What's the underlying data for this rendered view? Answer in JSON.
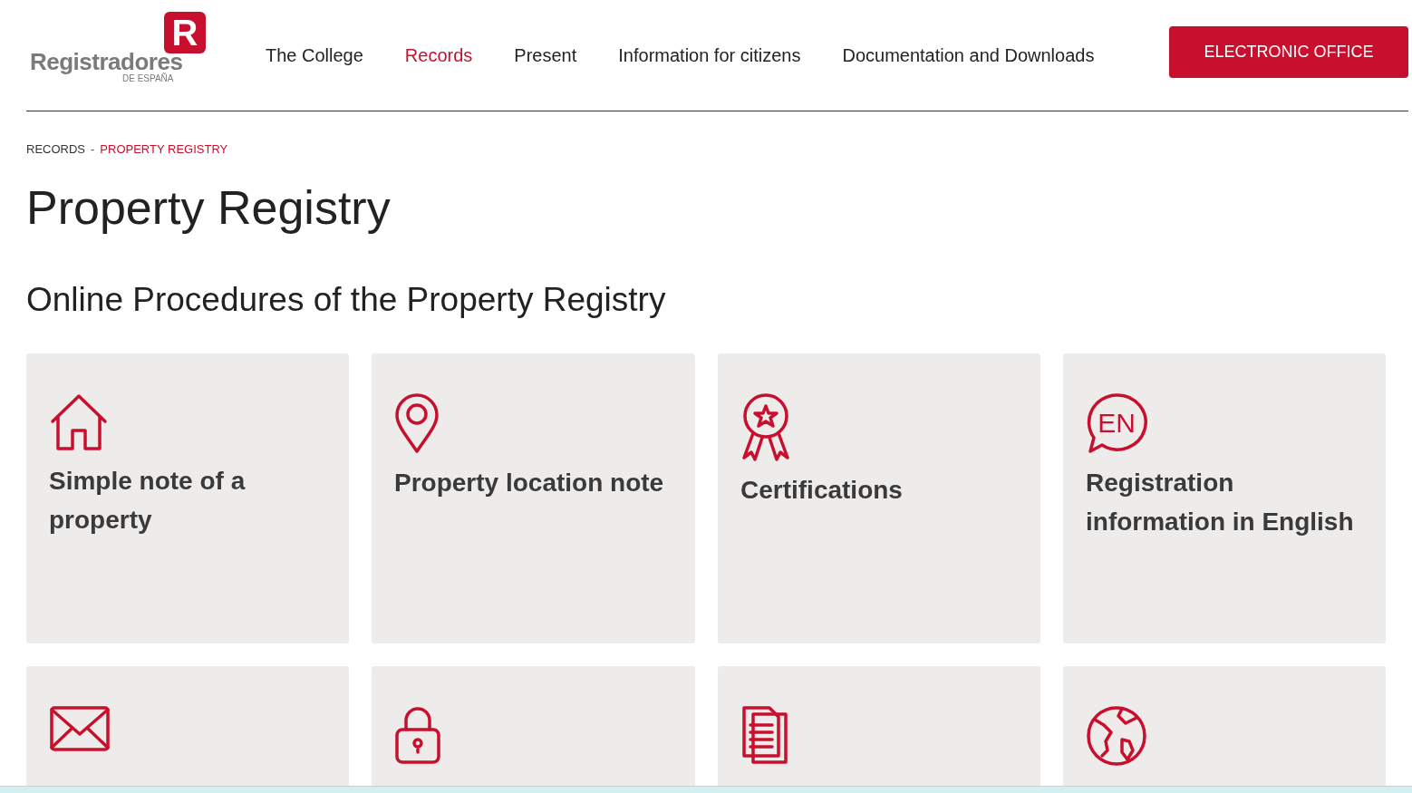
{
  "logo": {
    "mark": "R",
    "name": "Registradores",
    "subtitle": "DE ESPAÑA"
  },
  "nav": [
    {
      "label": "The College",
      "selected": false
    },
    {
      "label": "Records",
      "selected": true
    },
    {
      "label": "Present",
      "selected": false
    },
    {
      "label": "Information for citizens",
      "selected": false
    },
    {
      "label": "Documentation and Downloads",
      "selected": false
    }
  ],
  "cta": "ELECTRONIC OFFICE",
  "breadcrumb": [
    {
      "label": "RECORDS",
      "selected": false
    },
    {
      "label": "PROPERTY REGISTRY",
      "selected": true
    }
  ],
  "breadcrumb_separator": "-",
  "title": "Property Registry",
  "section_title": "Online Procedures of the Property Registry",
  "cards": [
    {
      "kind": "house",
      "title": "Simple note of a property"
    },
    {
      "kind": "pin",
      "title": "Property location note"
    },
    {
      "kind": "award",
      "title": "Certifications"
    },
    {
      "kind": "speech",
      "icon_text": "EN",
      "title": "Registration information in English"
    },
    {
      "kind": "mail"
    },
    {
      "kind": "lock"
    },
    {
      "kind": "document"
    },
    {
      "kind": "globe"
    }
  ]
}
